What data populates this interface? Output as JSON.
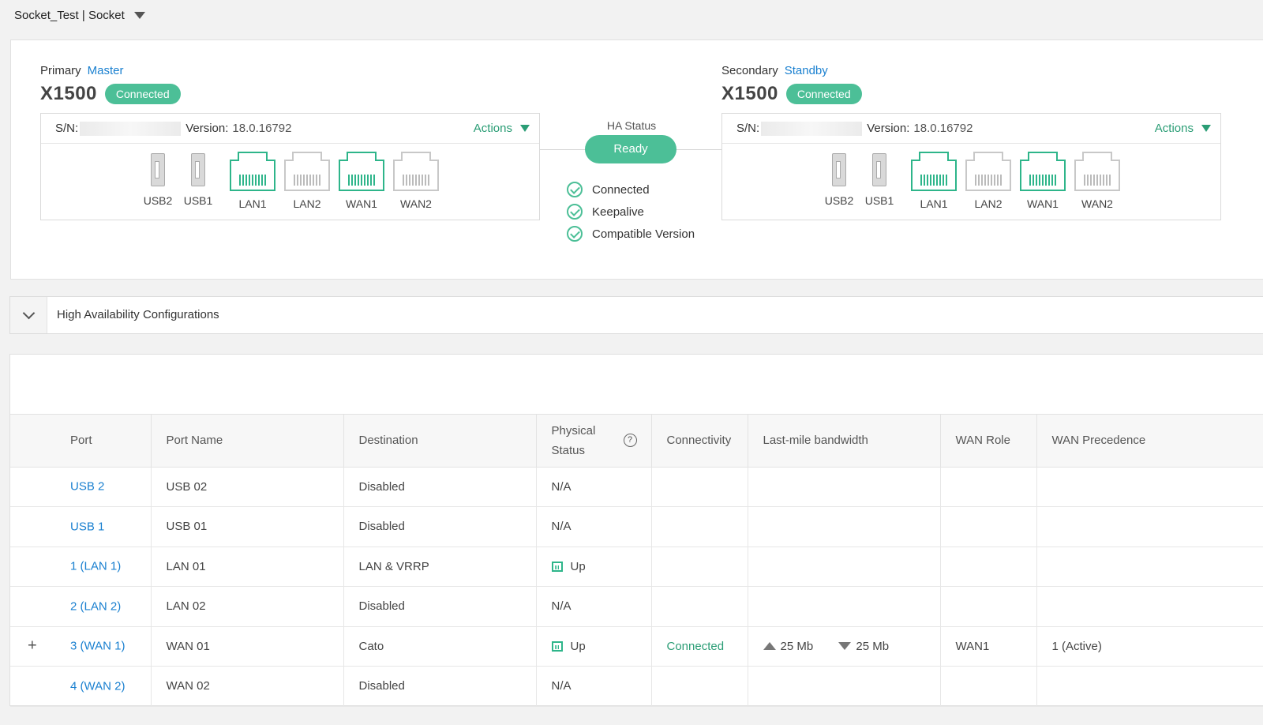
{
  "header": {
    "title": "Socket_Test | Socket"
  },
  "ha": {
    "primary": {
      "role": "Primary",
      "state": "Master",
      "model": "X1500",
      "status": "Connected",
      "sn_label": "S/N:",
      "version_label": "Version:",
      "version": "18.0.16792",
      "actions_label": "Actions",
      "ports": {
        "usb2": "USB2",
        "usb1": "USB1",
        "lan1": "LAN1",
        "lan2": "LAN2",
        "wan1": "WAN1",
        "wan2": "WAN2"
      }
    },
    "secondary": {
      "role": "Secondary",
      "state": "Standby",
      "model": "X1500",
      "status": "Connected",
      "sn_label": "S/N:",
      "version_label": "Version:",
      "version": "18.0.16792",
      "actions_label": "Actions",
      "ports": {
        "usb2": "USB2",
        "usb1": "USB1",
        "lan1": "LAN1",
        "lan2": "LAN2",
        "wan1": "WAN1",
        "wan2": "WAN2"
      }
    },
    "status_title": "HA Status",
    "status_value": "Ready",
    "checks": [
      "Connected",
      "Keepalive",
      "Compatible Version"
    ]
  },
  "accordion": {
    "title": "High Availability Configurations"
  },
  "table": {
    "headers": {
      "port": "Port",
      "port_name": "Port Name",
      "destination": "Destination",
      "physical_line1": "Physical",
      "physical_line2": "Status",
      "connectivity": "Connectivity",
      "bandwidth": "Last-mile bandwidth",
      "wan_role": "WAN Role",
      "wan_precedence": "WAN Precedence"
    },
    "rows": [
      {
        "port": "USB 2",
        "port_name": "USB 02",
        "destination": "Disabled",
        "physical": "N/A"
      },
      {
        "port": "USB 1",
        "port_name": "USB 01",
        "destination": "Disabled",
        "physical": "N/A"
      },
      {
        "port": "1 (LAN 1)",
        "port_name": "LAN 01",
        "destination": "LAN & VRRP",
        "physical": "Up"
      },
      {
        "port": "2 (LAN 2)",
        "port_name": "LAN 02",
        "destination": "Disabled",
        "physical": "N/A"
      },
      {
        "expand": "+",
        "port": "3 (WAN 1)",
        "port_name": "WAN 01",
        "destination": "Cato",
        "physical": "Up",
        "connectivity": "Connected",
        "bw_up": "25 Mb",
        "bw_down": "25 Mb",
        "wan_role": "WAN1",
        "wan_precedence": "1 (Active)"
      },
      {
        "port": "4 (WAN 2)",
        "port_name": "WAN 02",
        "destination": "Disabled",
        "physical": "N/A"
      }
    ]
  },
  "colors": {
    "accent_green": "#4cbf97",
    "link_blue": "#1a80d0",
    "port_active": "#2eb58a"
  },
  "icons": [
    "chevron-down-icon",
    "usb-port-icon",
    "ethernet-port-icon",
    "check-circle-icon",
    "help-icon",
    "upload-arrow-icon",
    "download-arrow-icon",
    "expand-plus-icon"
  ]
}
